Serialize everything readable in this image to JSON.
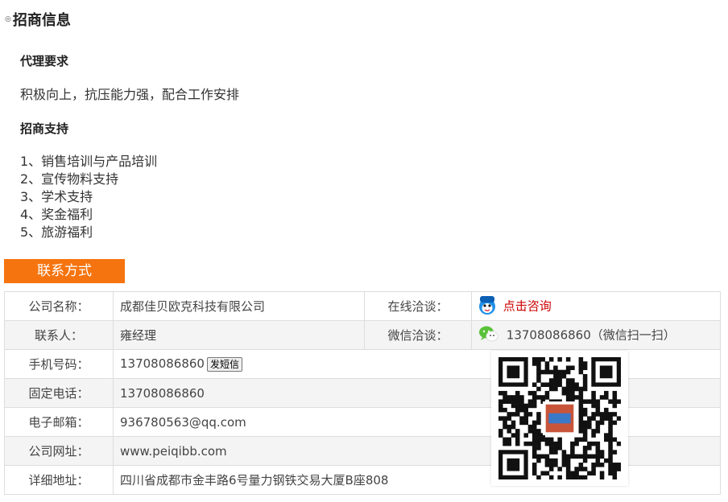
{
  "section": {
    "title": "招商信息"
  },
  "agency": {
    "requirements_heading": "代理要求",
    "requirements_text": "积极向上，抗压能力强，配合工作安排",
    "support_heading": "招商支持",
    "support_items": [
      "1、销售培训与产品培训",
      "2、宣传物料支持",
      "3、学术支持",
      "4、奖金福利",
      "5、旅游福利"
    ]
  },
  "contact": {
    "heading": "联系方式",
    "company_label": "公司名称：",
    "company_value": "成都佳贝欧克科技有限公司",
    "online_label": "在线洽谈：",
    "online_link": "点击咨询",
    "person_label": "联系人：",
    "person_value": "雍经理",
    "wechat_label": "微信洽谈：",
    "wechat_value": "13708086860（微信扫一扫）",
    "mobile_label": "手机号码：",
    "mobile_value": "13708086860",
    "sms_button": "发短信",
    "phone_label": "固定电话：",
    "phone_value": "13708086860",
    "email_label": "电子邮箱：",
    "email_value": "936780563@qq.com",
    "website_label": "公司网址：",
    "website_value": "www.peiqibb.com",
    "address_label": "详细地址：",
    "address_value": "四川省成都市金丰路6号量力钢铁交易大厦B座808"
  },
  "colors": {
    "accent": "#f5740f",
    "link": "#cc0000",
    "border": "#dddddd",
    "row_alt": "#f4f4f4"
  },
  "icons": {
    "bullet": "circle-bullet-icon",
    "qq": "qq-penguin-icon",
    "wechat": "wechat-icon",
    "qr": "qr-code-icon"
  }
}
